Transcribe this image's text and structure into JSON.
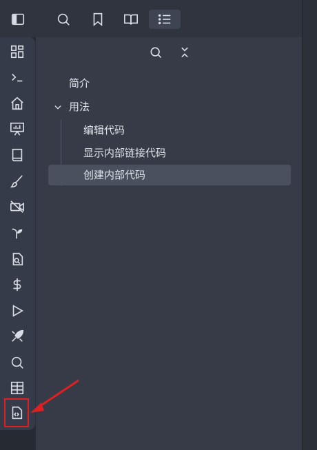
{
  "ribbon": {
    "toggle_icon": "sidebar-toggle-icon",
    "items": [
      {
        "name": "grid-icon"
      },
      {
        "name": "terminal-icon"
      },
      {
        "name": "home-icon"
      },
      {
        "name": "presentation-icon"
      },
      {
        "name": "book-icon"
      },
      {
        "name": "brush-icon"
      },
      {
        "name": "camera-off-icon"
      },
      {
        "name": "sprout-icon"
      },
      {
        "name": "file-search-icon"
      },
      {
        "name": "dollar-icon"
      },
      {
        "name": "play-icon"
      },
      {
        "name": "rocket-icon"
      },
      {
        "name": "search-icon"
      },
      {
        "name": "table-icon"
      },
      {
        "name": "file-code-icon"
      }
    ]
  },
  "header": {
    "tabs": [
      {
        "name": "search-icon"
      },
      {
        "name": "bookmark-icon"
      },
      {
        "name": "book-open-icon"
      },
      {
        "name": "list-icon",
        "active": true
      }
    ]
  },
  "outline": {
    "items": [
      {
        "label": "简介",
        "level": 0
      },
      {
        "label": "用法",
        "level": 0,
        "collapsible": true
      },
      {
        "label": "编辑代码",
        "level": 1
      },
      {
        "label": "显示内部链接代码",
        "level": 1
      },
      {
        "label": "创建内部代码",
        "level": 1,
        "selected": true
      }
    ]
  },
  "colors": {
    "background": "#363b47",
    "ribbon": "#262a33",
    "header": "#2f343e",
    "icon": "#d8dce4",
    "selected": "#4a505e",
    "annotation": "#e02020"
  }
}
